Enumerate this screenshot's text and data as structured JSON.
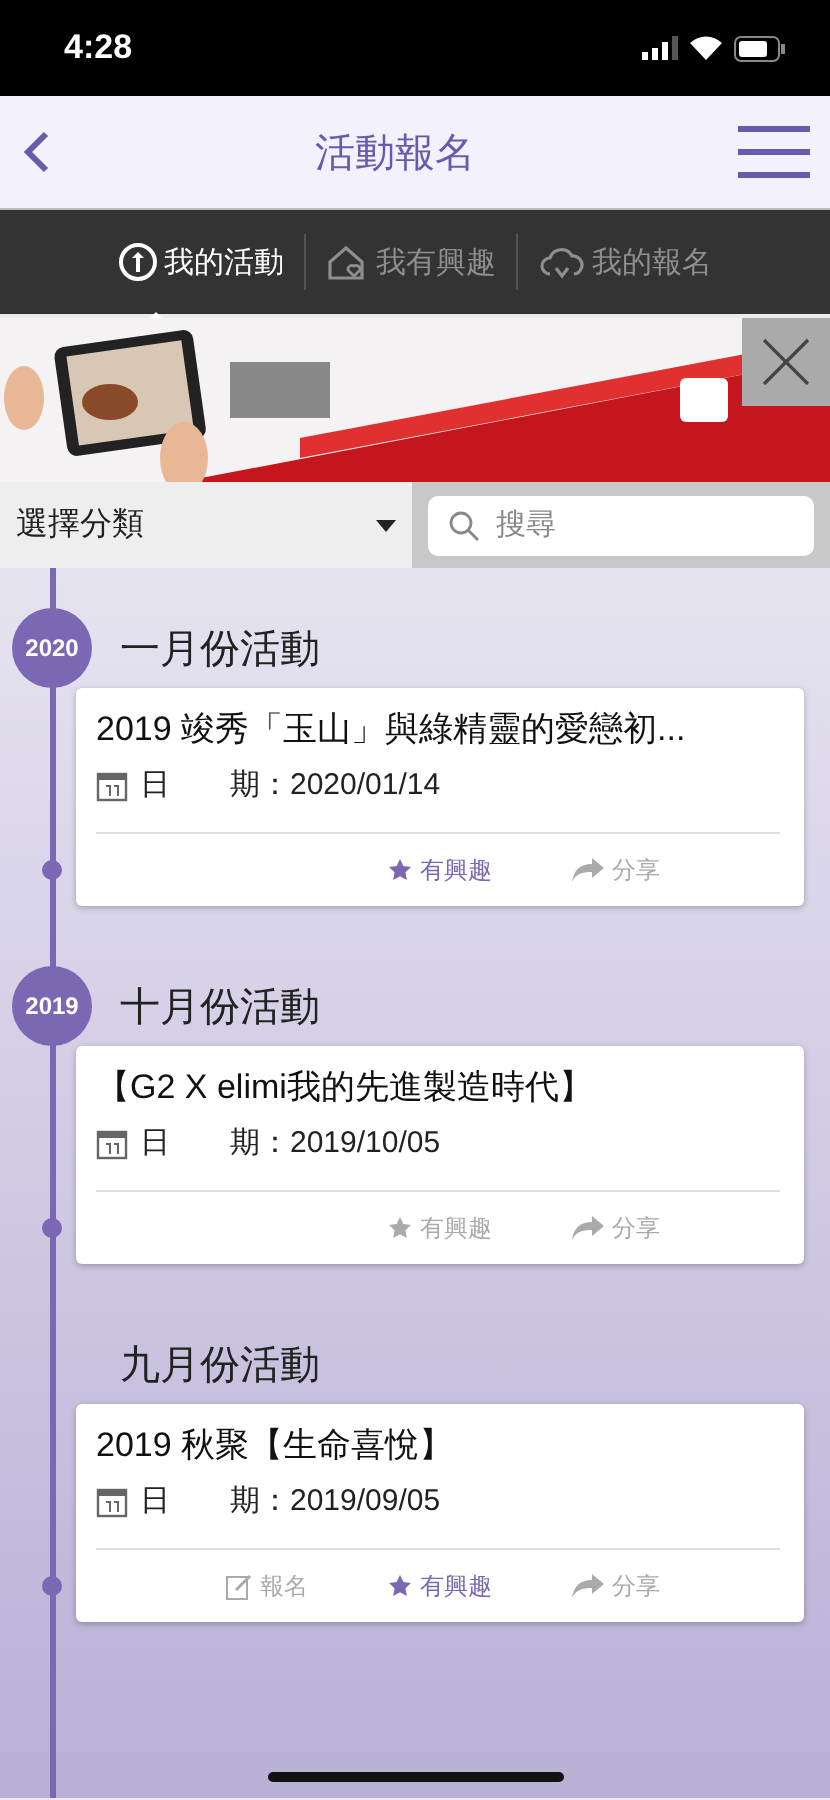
{
  "status_bar": {
    "time": "4:28"
  },
  "nav": {
    "title": "活動報名"
  },
  "tabs": [
    {
      "kind": "info",
      "label": "我的活動",
      "selected": true
    },
    {
      "kind": "house",
      "label": "我有興趣",
      "selected": false
    },
    {
      "kind": "cloud",
      "label": "我的報名",
      "selected": false
    }
  ],
  "filter": {
    "category": "選擇分類",
    "search": {
      "placeholder": "搜尋"
    }
  },
  "groups": [
    {
      "year": "2020",
      "title": "一月份活動",
      "events": [
        {
          "title": "2019 竣秀「玉山」與綠精靈的愛戀初...",
          "date_label": "日　　期：",
          "date": "2020/01/14",
          "actions": [
            {
              "kind": "interest",
              "label": "有興趣",
              "selected": true
            },
            {
              "kind": "share",
              "label": "分享",
              "selected": false
            }
          ]
        }
      ]
    },
    {
      "year": "2019",
      "title": "十月份活動",
      "events": [
        {
          "title": "【G2 X elimi我的先進製造時代】",
          "date_label": "日　　期：",
          "date": "2019/10/05",
          "actions": [
            {
              "kind": "interest",
              "label": "有興趣",
              "selected": false
            },
            {
              "kind": "share",
              "label": "分享",
              "selected": false
            }
          ]
        }
      ]
    },
    {
      "title": "九月份活動",
      "events": [
        {
          "title": "2019 秋聚【生命喜悅】",
          "date_label": "日　　期：",
          "date": "2019/09/05",
          "actions": [
            {
              "kind": "signup",
              "label": "報名",
              "selected": false
            },
            {
              "kind": "interest",
              "label": "有興趣",
              "selected": true
            },
            {
              "kind": "share",
              "label": "分享",
              "selected": false
            }
          ]
        }
      ]
    }
  ]
}
